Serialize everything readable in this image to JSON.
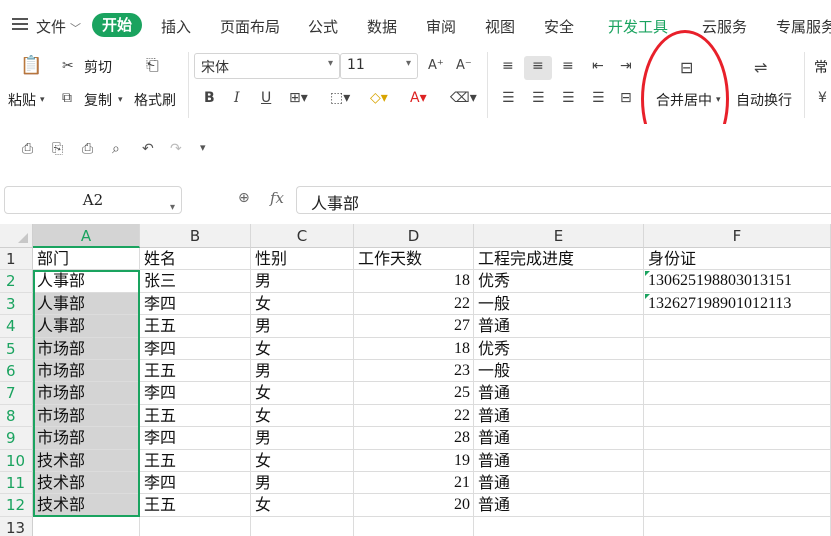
{
  "menu": {
    "file": "文件",
    "tabs": [
      "开始",
      "插入",
      "页面布局",
      "公式",
      "数据",
      "审阅",
      "视图",
      "安全",
      "开发工具",
      "云服务",
      "专属服务"
    ]
  },
  "ribbon": {
    "paste": "粘贴",
    "cut": "剪切",
    "copy": "复制",
    "format_painter": "格式刷",
    "font_name": "宋体",
    "font_size": "11",
    "merge_center": "合并居中",
    "wrap_text": "自动换行",
    "number_format_partial": "常"
  },
  "formula_bar": {
    "cell_ref": "A2",
    "fx": "fx",
    "content": "人事部"
  },
  "grid": {
    "columns": [
      "A",
      "B",
      "C",
      "D",
      "E",
      "F"
    ],
    "selected_column": "A",
    "rows": [
      {
        "n": "1",
        "cells": [
          "部门",
          "姓名",
          "性别",
          "工作天数",
          "工程完成进度",
          "身份证"
        ]
      },
      {
        "n": "2",
        "cells": [
          "人事部",
          "张三",
          "男",
          "18",
          "优秀",
          "130625198803013151"
        ]
      },
      {
        "n": "3",
        "cells": [
          "人事部",
          "李四",
          "女",
          "22",
          "一般",
          "132627198901012113"
        ]
      },
      {
        "n": "4",
        "cells": [
          "人事部",
          "王五",
          "男",
          "27",
          "普通",
          ""
        ]
      },
      {
        "n": "5",
        "cells": [
          "市场部",
          "李四",
          "女",
          "18",
          "优秀",
          ""
        ]
      },
      {
        "n": "6",
        "cells": [
          "市场部",
          "王五",
          "男",
          "23",
          "一般",
          ""
        ]
      },
      {
        "n": "7",
        "cells": [
          "市场部",
          "李四",
          "女",
          "25",
          "普通",
          ""
        ]
      },
      {
        "n": "8",
        "cells": [
          "市场部",
          "王五",
          "女",
          "22",
          "普通",
          ""
        ]
      },
      {
        "n": "9",
        "cells": [
          "市场部",
          "李四",
          "男",
          "28",
          "普通",
          ""
        ]
      },
      {
        "n": "10",
        "cells": [
          "技术部",
          "王五",
          "女",
          "19",
          "普通",
          ""
        ]
      },
      {
        "n": "11",
        "cells": [
          "技术部",
          "李四",
          "男",
          "21",
          "普通",
          ""
        ]
      },
      {
        "n": "12",
        "cells": [
          "技术部",
          "王五",
          "女",
          "20",
          "普通",
          ""
        ]
      },
      {
        "n": "13",
        "cells": [
          "",
          "",
          "",
          "",
          "",
          ""
        ]
      }
    ]
  },
  "colors": {
    "accent_green": "#1aa35f",
    "annotation_red": "#e8202a",
    "selection_gray": "#d4d4d4"
  }
}
